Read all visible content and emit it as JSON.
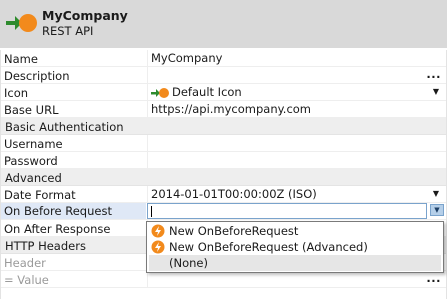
{
  "header": {
    "title": "MyCompany",
    "subtitle": "REST API",
    "icon": "rest-api-icon"
  },
  "properties": {
    "name": {
      "label": "Name",
      "value": "MyCompany"
    },
    "description": {
      "label": "Description",
      "value": "",
      "ellipsis": "..."
    },
    "icon": {
      "label": "Icon",
      "value": "Default Icon"
    },
    "base_url": {
      "label": "Base URL",
      "value": "https://api.mycompany.com"
    },
    "basic_auth": {
      "label": "Basic Authentication"
    },
    "username": {
      "label": "Username",
      "value": ""
    },
    "password": {
      "label": "Password",
      "value": ""
    },
    "advanced": {
      "label": "Advanced"
    },
    "date_format": {
      "label": "Date Format",
      "value": "2014-01-01T00:00:00Z (ISO)"
    },
    "on_before_request": {
      "label": "On Before Request",
      "value": ""
    },
    "on_after_response": {
      "label": "On After Response",
      "value": ""
    },
    "http_headers": {
      "label": "HTTP Headers"
    },
    "header": {
      "label": "Header"
    },
    "value": {
      "label": "= Value",
      "ellipsis": "..."
    }
  },
  "dropdown": {
    "options": [
      {
        "label": "New OnBeforeRequest",
        "icon": "lightning-icon"
      },
      {
        "label": "New OnBeforeRequest (Advanced)",
        "icon": "lightning-icon"
      },
      {
        "label": "(None)",
        "selected": true
      }
    ]
  },
  "colors": {
    "header_bg": "#d9d9d9",
    "category_bg": "#eeeeee",
    "selection_bg": "#dfe8f6",
    "accent_orange": "#f28a1c",
    "accent_green": "#2e8b2e"
  }
}
